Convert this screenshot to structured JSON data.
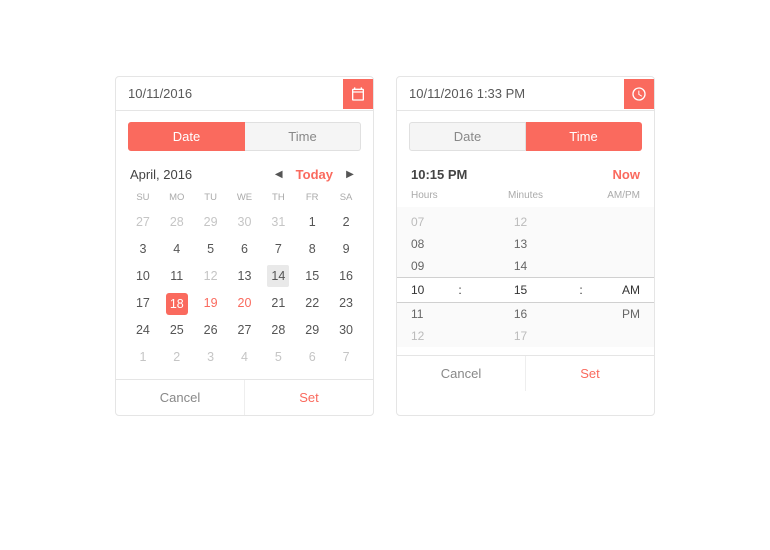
{
  "left": {
    "input_value": "10/11/2016",
    "tabs": {
      "date": "Date",
      "time": "Time"
    },
    "nav": {
      "title": "April, 2016",
      "today": "Today"
    },
    "dow": [
      "SU",
      "MO",
      "TU",
      "WE",
      "TH",
      "FR",
      "SA"
    ],
    "weeks": [
      [
        {
          "d": "27",
          "c": "muted"
        },
        {
          "d": "28",
          "c": "muted"
        },
        {
          "d": "29",
          "c": "muted"
        },
        {
          "d": "30",
          "c": "muted"
        },
        {
          "d": "31",
          "c": "muted"
        },
        {
          "d": "1"
        },
        {
          "d": "2"
        }
      ],
      [
        {
          "d": "3"
        },
        {
          "d": "4"
        },
        {
          "d": "5"
        },
        {
          "d": "6"
        },
        {
          "d": "7"
        },
        {
          "d": "8"
        },
        {
          "d": "9"
        }
      ],
      [
        {
          "d": "10"
        },
        {
          "d": "11"
        },
        {
          "d": "12",
          "c": "muted"
        },
        {
          "d": "13"
        },
        {
          "d": "14",
          "c": "hover"
        },
        {
          "d": "15"
        },
        {
          "d": "16"
        }
      ],
      [
        {
          "d": "17"
        },
        {
          "d": "18",
          "c": "selected"
        },
        {
          "d": "19",
          "c": "accent"
        },
        {
          "d": "20",
          "c": "accent"
        },
        {
          "d": "21"
        },
        {
          "d": "22"
        },
        {
          "d": "23"
        }
      ],
      [
        {
          "d": "24"
        },
        {
          "d": "25"
        },
        {
          "d": "26"
        },
        {
          "d": "27"
        },
        {
          "d": "28"
        },
        {
          "d": "29"
        },
        {
          "d": "30"
        }
      ],
      [
        {
          "d": "1",
          "c": "muted"
        },
        {
          "d": "2",
          "c": "muted"
        },
        {
          "d": "3",
          "c": "muted"
        },
        {
          "d": "4",
          "c": "muted"
        },
        {
          "d": "5",
          "c": "muted"
        },
        {
          "d": "6",
          "c": "muted"
        },
        {
          "d": "7",
          "c": "muted"
        }
      ]
    ],
    "cancel": "Cancel",
    "set": "Set"
  },
  "right": {
    "input_value": "10/11/2016 1:33 PM",
    "tabs": {
      "date": "Date",
      "time": "Time"
    },
    "current": "10:15 PM",
    "now": "Now",
    "labels": {
      "h": "Hours",
      "m": "Minutes",
      "ap": "AM/PM"
    },
    "rows": [
      {
        "h": "07",
        "m": "12",
        "ap": "",
        "cls": ""
      },
      {
        "h": "08",
        "m": "13",
        "ap": "",
        "cls": "dark"
      },
      {
        "h": "09",
        "m": "14",
        "ap": "",
        "cls": "dark"
      },
      {
        "h": "10",
        "m": "15",
        "ap": "AM",
        "cls": "sel"
      },
      {
        "h": "11",
        "m": "16",
        "ap": "PM",
        "cls": "dark"
      },
      {
        "h": "12",
        "m": "17",
        "ap": "",
        "cls": ""
      }
    ],
    "cancel": "Cancel",
    "set": "Set"
  }
}
